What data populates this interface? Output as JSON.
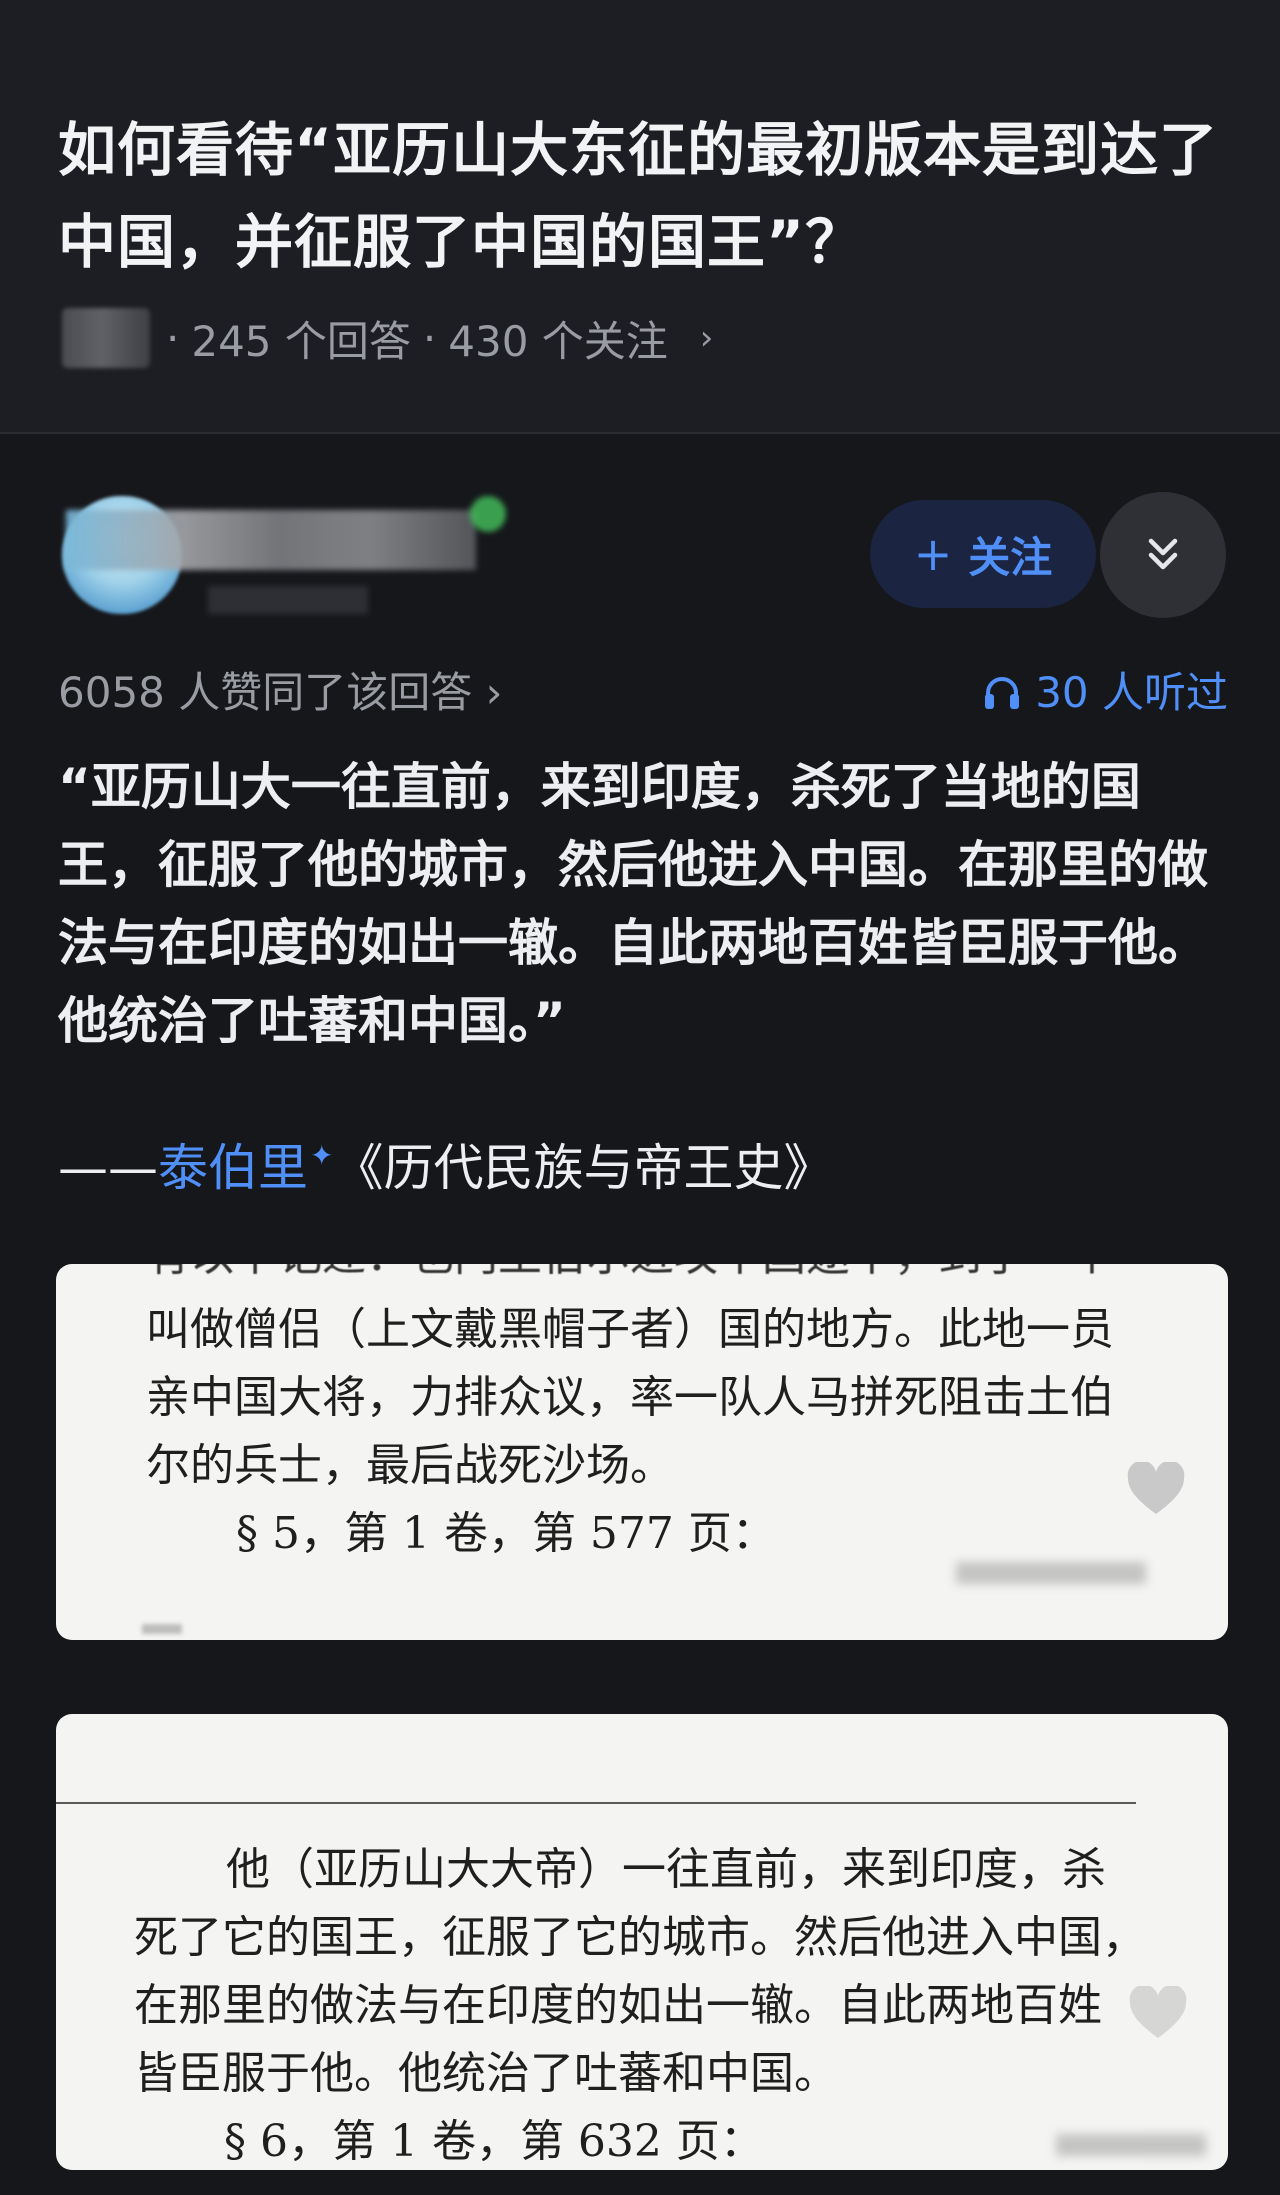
{
  "question": {
    "title": "如何看待“亚历山大东征的最初版本是到达了中国，并征服了中国的国王”？",
    "meta": {
      "answers": "245 个回答",
      "followers": "430 个关注",
      "separator": "·",
      "chevron": "›"
    }
  },
  "author": {
    "follow_label": "关注",
    "follow_icon": "+",
    "collapse_icon": "chevron-double-down-icon"
  },
  "stats": {
    "upvotes": "6058 人赞同了该回答 ›",
    "listeners": "30 人听过",
    "listen_icon": "headphones-icon"
  },
  "answer": {
    "quote": "“亚历山大一往直前，来到印度，杀死了当地的国王，征服了他的城市，然后他进入中国。在那里的做法与在印度的如出一辙。自此两地百姓皆臣服于他。他统治了吐蕃和中国。”",
    "citation_dash": "——",
    "citation_author": "泰伯里",
    "citation_book": "《历代民族与帝王史》"
  },
  "scans": [
    {
      "cut_line": "有以下记述：也门王伯尔进攻中国途中，到了一个",
      "lines": [
        "叫做僧侣（上文戴黑帽子者）国的地方。此地一员",
        "亲中国大将，力排众议，率一队人马拼死阻击土伯",
        "尔的兵士，最后战死沙场。"
      ],
      "reference": "§ 5，第 1 卷，第 577 页："
    },
    {
      "lines": [
        "他（亚历山大大帝）一往直前，来到印度，杀",
        "死了它的国王，征服了它的城市。然后他进入中国，",
        "在那里的做法与在印度的如出一辙。自此两地百姓",
        "皆臣服于他。他统治了吐蕃和中国。"
      ],
      "reference": "§ 6，第 1 卷，第 632 页："
    }
  ],
  "colors": {
    "background": "#16171b",
    "header": "#1d1e23",
    "accent": "#4f8ff7",
    "muted_text": "#9a9ca3",
    "scan_paper": "#f4f4f2"
  }
}
